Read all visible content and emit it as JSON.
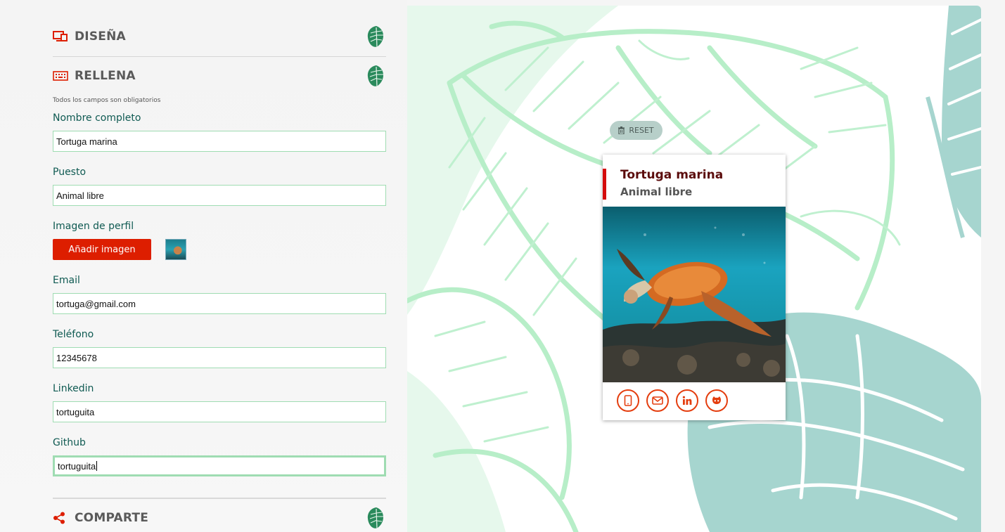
{
  "sections": {
    "design": {
      "title": "DISEÑA",
      "icon": "design-monitor-icon"
    },
    "fill": {
      "title": "RELLENA",
      "icon": "keyboard-icon"
    },
    "share": {
      "title": "COMPARTE",
      "icon": "share-icon"
    }
  },
  "form": {
    "note": "Todos los campos son obligatorios",
    "name": {
      "label": "Nombre completo",
      "value": "Tortuga marina"
    },
    "job": {
      "label": "Puesto",
      "value": "Animal libre"
    },
    "image": {
      "label": "Imagen de perfil",
      "button": "Añadir imagen"
    },
    "email": {
      "label": "Email",
      "value": "tortuga@gmail.com"
    },
    "phone": {
      "label": "Teléfono",
      "value": "12345678"
    },
    "linkedin": {
      "label": "Linkedin",
      "value": "tortuguita"
    },
    "github": {
      "label": "Github",
      "value": "tortuguita"
    }
  },
  "preview": {
    "reset_label": "RESET",
    "card": {
      "name": "Tortuga marina",
      "job": "Animal libre",
      "icons": [
        "phone-icon",
        "email-icon",
        "linkedin-icon",
        "github-icon"
      ]
    }
  },
  "colors": {
    "accent": "#dd1e00",
    "label": "#0f5a52",
    "input_border": "#9fdcb2",
    "card_name": "#5b0c0c",
    "leaf": "#2a8a5c",
    "bg_leaf_light": "#bff0cf",
    "bg_leaf_teal": "#a6d5cf"
  }
}
